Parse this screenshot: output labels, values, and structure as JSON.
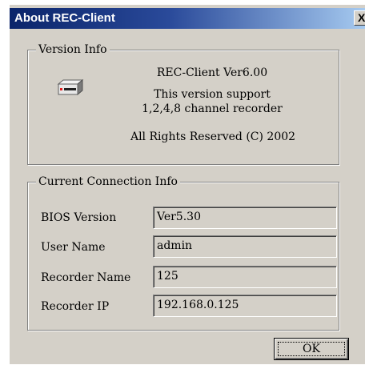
{
  "window": {
    "title": "About REC-Client",
    "close_label": "X"
  },
  "version_group": {
    "legend": "Version Info",
    "icon": "recorder-device-icon",
    "product": "REC-Client Ver6.00",
    "support_line1": "This version support",
    "support_line2": "1,2,4,8 channel recorder",
    "rights": "All Rights Reserved (C) 2002"
  },
  "connection_group": {
    "legend": "Current Connection Info",
    "fields": [
      {
        "label": "BIOS Version",
        "value": "Ver5.30"
      },
      {
        "label": "User Name",
        "value": "admin"
      },
      {
        "label": "Recorder Name",
        "value": "125"
      },
      {
        "label": "Recorder IP",
        "value": "192.168.0.125"
      }
    ]
  },
  "buttons": {
    "ok_label": "OK"
  },
  "colors": {
    "dialog_face": "#d4d0c8",
    "titlebar_start": "#0a246a",
    "titlebar_end": "#a6caf0"
  }
}
